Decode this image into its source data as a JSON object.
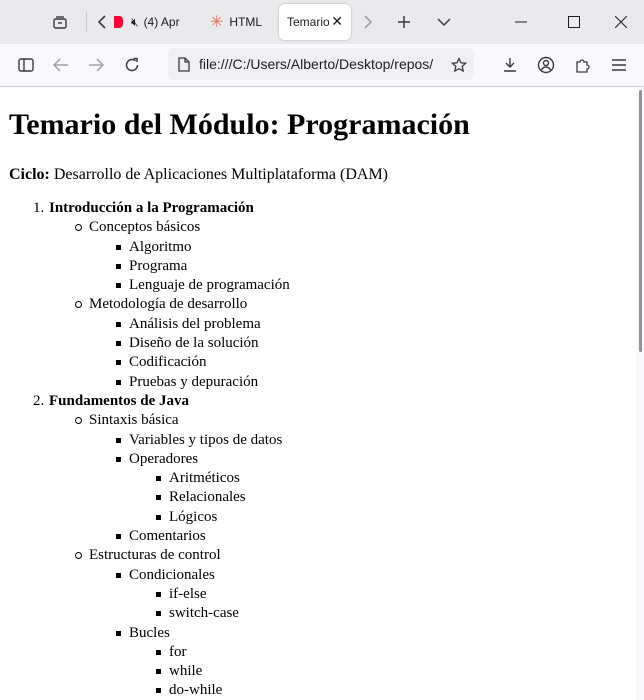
{
  "browser": {
    "tabs": [
      {
        "label": "(4) Apr",
        "active": false
      },
      {
        "label": "HTML",
        "active": false
      },
      {
        "label": "Temario",
        "active": true
      }
    ],
    "url": "file:///C:/Users/Alberto/Desktop/repos/"
  },
  "doc": {
    "title": "Temario del Módulo: Programación",
    "ciclo_label": "Ciclo:",
    "ciclo_value": " Desarrollo de Aplicaciones Multiplataforma (DAM)",
    "items": [
      {
        "n": "1.",
        "label": "Introducción a la Programación",
        "level": 0
      },
      {
        "label": "Conceptos básicos",
        "level": 1
      },
      {
        "label": "Algoritmo",
        "level": 2
      },
      {
        "label": "Programa",
        "level": 2
      },
      {
        "label": "Lenguaje de programación",
        "level": 2
      },
      {
        "label": "Metodología de desarrollo",
        "level": 1
      },
      {
        "label": "Análisis del problema",
        "level": 2
      },
      {
        "label": "Diseño de la solución",
        "level": 2
      },
      {
        "label": "Codificación",
        "level": 2
      },
      {
        "label": "Pruebas y depuración",
        "level": 2
      },
      {
        "n": "2.",
        "label": "Fundamentos de Java",
        "level": 0
      },
      {
        "label": "Sintaxis básica",
        "level": 1
      },
      {
        "label": "Variables y tipos de datos",
        "level": 2
      },
      {
        "label": "Operadores",
        "level": 2
      },
      {
        "label": "Aritméticos",
        "level": 3
      },
      {
        "label": "Relacionales",
        "level": 3
      },
      {
        "label": "Lógicos",
        "level": 3
      },
      {
        "label": "Comentarios",
        "level": 2
      },
      {
        "label": "Estructuras de control",
        "level": 1
      },
      {
        "label": "Condicionales",
        "level": 2
      },
      {
        "label": "if-else",
        "level": 3
      },
      {
        "label": "switch-case",
        "level": 3
      },
      {
        "label": "Bucles",
        "level": 2
      },
      {
        "label": "for",
        "level": 3
      },
      {
        "label": "while",
        "level": 3
      },
      {
        "label": "do-while",
        "level": 3
      }
    ]
  }
}
